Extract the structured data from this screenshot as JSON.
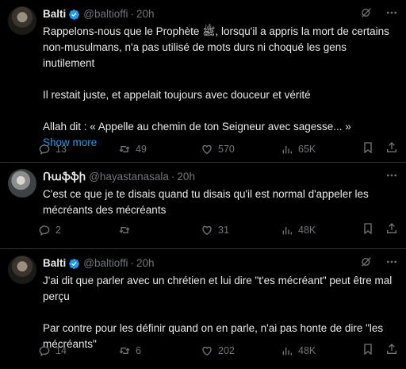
{
  "tweets": [
    {
      "name": "Balti",
      "handle": "@baltioffi",
      "time": "20h",
      "text": "Rappelons-nous que le Prophète ﷺ, lorsqu'il a appris la mort de certains non-musulmans, n'a pas utilisé de mots durs ni choqué les gens inutilement\n\nIl restait juste, et appelait toujours avec douceur et vérité\n\nAllah dit : « Appelle au chemin de ton Seigneur avec sagesse... »",
      "show_more": "Show more",
      "replies": "13",
      "reposts": "49",
      "likes": "570",
      "views": "65K"
    },
    {
      "name": "Ռաֆֆի",
      "handle": "@hayastanasala",
      "time": "20h",
      "text": "C'est ce que je te disais quand tu disais qu'il est normal d'appeler les mécréants des mécréants",
      "replies": "2",
      "reposts": "",
      "likes": "31",
      "views": "48K"
    },
    {
      "name": "Balti",
      "handle": "@baltioffi",
      "time": "20h",
      "text": "J'ai dit que parler avec un chrétien et lui dire \"t'es mécréant\" peut être mal perçu\n\nPar contre pour les définir quand on en parle, n'ai pas honte de dire \"les mécréants\"",
      "replies": "14",
      "reposts": "6",
      "likes": "202",
      "views": "48K"
    }
  ],
  "dot": "·",
  "colors": {
    "accent": "#1d9bf0",
    "muted": "#71767b",
    "text": "#e7e9ea",
    "divider": "#2f3336"
  }
}
